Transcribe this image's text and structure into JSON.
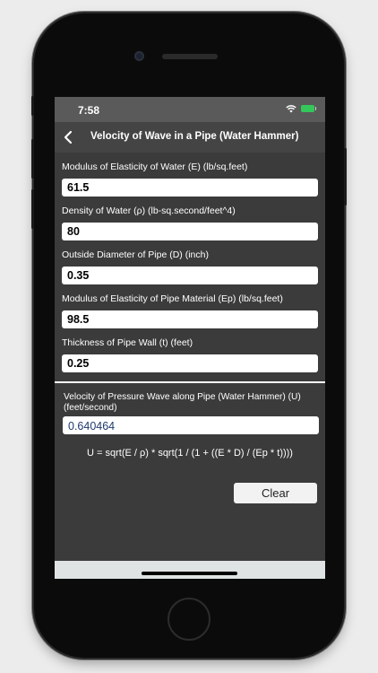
{
  "status": {
    "time": "7:58",
    "battery_color": "#34c759"
  },
  "nav": {
    "title": "Velocity of Wave in a Pipe (Water Hammer)",
    "back_icon": "chevron-left-icon"
  },
  "fields": [
    {
      "label": "Modulus of Elasticity of Water (E) (lb/sq.feet)",
      "value": "61.5"
    },
    {
      "label": "Density of Water (ρ) (lb-sq.second/feet^4)",
      "value": "80"
    },
    {
      "label": "Outside Diameter of Pipe (D) (inch)",
      "value": "0.35"
    },
    {
      "label": "Modulus of Elasticity of Pipe Material (Ep) (lb/sq.feet)",
      "value": "98.5"
    },
    {
      "label": "Thickness of Pipe Wall (t) (feet)",
      "value": "0.25"
    }
  ],
  "result": {
    "label": "Velocity of Pressure Wave along Pipe (Water Hammer) (U) (feet/second)",
    "value": "0.640464"
  },
  "formula": "U = sqrt(E / ρ) *  sqrt(1 / (1 + ((E * D) / (Ep * t))))",
  "clear_label": "Clear"
}
